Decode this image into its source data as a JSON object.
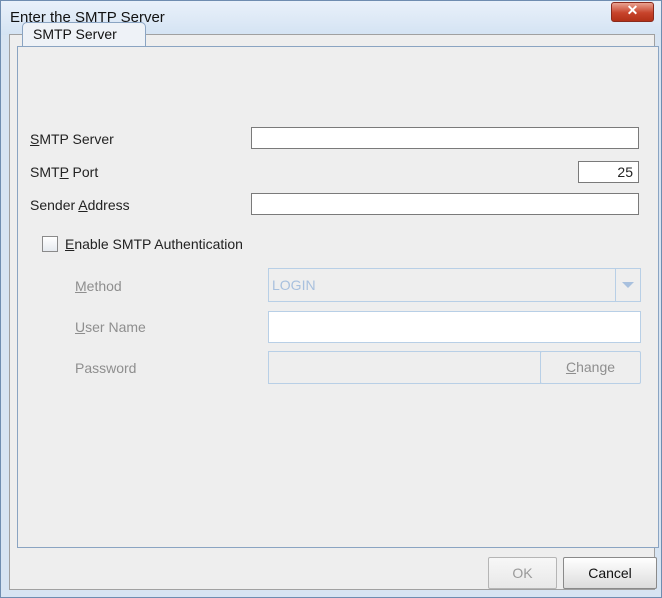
{
  "window": {
    "title": "Enter the SMTP Server"
  },
  "tabs": [
    {
      "label": "SMTP Server"
    }
  ],
  "form": {
    "smtp_server": {
      "mnemonic": "S",
      "rest": "MTP Server",
      "value": ""
    },
    "smtp_port": {
      "prefix": "SMT",
      "mnemonic": "P",
      "suffix": " Port",
      "value": "25"
    },
    "sender_address": {
      "prefix": "Sender ",
      "mnemonic": "A",
      "suffix": "ddress",
      "value": ""
    },
    "enable_auth": {
      "mnemonic": "E",
      "rest": "nable SMTP Authentication",
      "checked": false
    },
    "method": {
      "mnemonic": "M",
      "rest": "ethod",
      "selected": "LOGIN"
    },
    "user_name": {
      "mnemonic": "U",
      "rest": "ser Name",
      "value": ""
    },
    "password": {
      "label": "Password",
      "value": "",
      "change_mnemonic": "C",
      "change_rest": "hange"
    }
  },
  "footer": {
    "ok_label": "OK",
    "cancel_label": "Cancel"
  },
  "icons": {
    "close": "close-icon",
    "dropdown": "chevron-down-icon"
  }
}
